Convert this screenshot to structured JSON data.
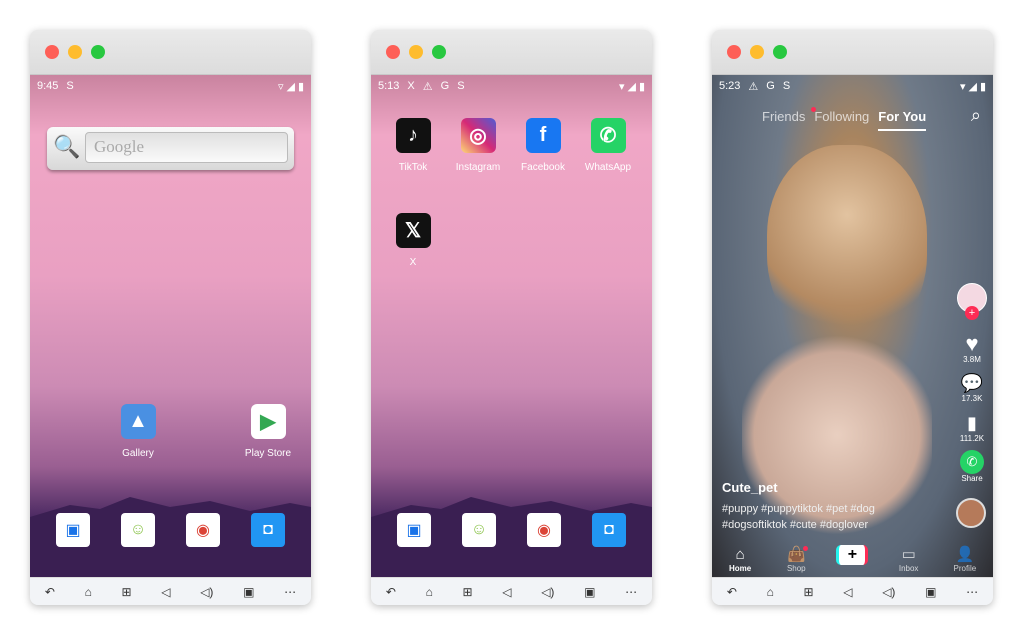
{
  "colors": {
    "close": "#fe5f57",
    "minimize": "#febc2e",
    "maximize": "#28c840",
    "tiktok_red": "#fe2c55",
    "whatsapp": "#25d366"
  },
  "navbar": {
    "icons": [
      "back-icon",
      "home-icon",
      "apps-icon",
      "volume-down-icon",
      "volume-up-icon",
      "screen-cast-icon",
      "more-icon"
    ]
  },
  "phone1": {
    "time": "9:45",
    "status_icon": "S",
    "search_placeholder": "Google",
    "apps": [
      {
        "label": "Gallery",
        "icon": "gallery-icon"
      },
      {
        "label": "Play Store",
        "icon": "play-store-icon"
      }
    ],
    "dock": [
      "contacts-icon",
      "store-icon",
      "chrome-icon",
      "camera-icon"
    ]
  },
  "phone2": {
    "time": "5:13",
    "status_icons": [
      "X",
      "⚠",
      "G",
      "S"
    ],
    "apps": [
      {
        "label": "TikTok"
      },
      {
        "label": "Instagram"
      },
      {
        "label": "Facebook"
      },
      {
        "label": "WhatsApp"
      },
      {
        "label": "X"
      }
    ],
    "dock": [
      "contacts-icon",
      "store-icon",
      "chrome-icon",
      "camera-icon"
    ]
  },
  "phone3": {
    "time": "5:23",
    "status_icons": [
      "⚠",
      "G",
      "S"
    ],
    "tabs": [
      "Friends",
      "Following",
      "For You"
    ],
    "active_tab": "For You",
    "likes": "3.8M",
    "comments": "17.3K",
    "saves": "111.2K",
    "share": "Share",
    "username": "Cute_pet",
    "caption_line1": "#puppy #puppytiktok #pet #dog",
    "caption_line2": "#dogsoftiktok #cute #doglover",
    "nav": [
      "Home",
      "Shop",
      "",
      "Inbox",
      "Profile"
    ]
  }
}
